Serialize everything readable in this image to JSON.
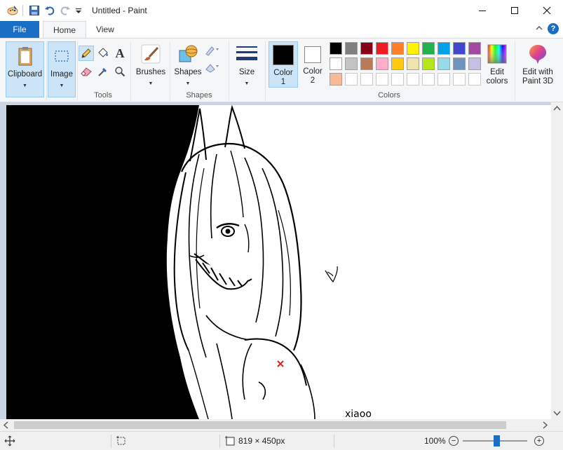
{
  "window": {
    "title": "Untitled - Paint",
    "controls": {
      "minimize": "—",
      "maximize": "☐",
      "close": "✕"
    }
  },
  "tabs": {
    "file": "File",
    "home": "Home",
    "view": "View"
  },
  "ribbon": {
    "clipboard": {
      "label": "Clipboard"
    },
    "image": {
      "label": "Image"
    },
    "tools": {
      "label": "Tools"
    },
    "brushes": {
      "label": "Brushes"
    },
    "shapes": {
      "label": "Shapes",
      "group_label": "Shapes"
    },
    "size": {
      "label": "Size"
    },
    "color1": {
      "label": "Color",
      "num": "1",
      "color": "#000000"
    },
    "color2": {
      "label": "Color",
      "num": "2",
      "color": "#ffffff"
    },
    "colors_group_label": "Colors",
    "edit_colors": {
      "line1": "Edit",
      "line2": "colors"
    },
    "paint3d": {
      "line1": "Edit with",
      "line2": "Paint 3D"
    },
    "palette_row1": [
      "#000000",
      "#7f7f7f",
      "#880015",
      "#ed1c24",
      "#ff7f27",
      "#fff200",
      "#22b14c",
      "#00a2e8",
      "#3f48cc",
      "#a349a4"
    ],
    "palette_row2": [
      "#ffffff",
      "#c3c3c3",
      "#b97a57",
      "#ffaec9",
      "#ffc90e",
      "#efe4b0",
      "#b5e61d",
      "#99d9ea",
      "#7092be",
      "#c8bfe7"
    ],
    "palette_row3": [
      "#f7b99a"
    ]
  },
  "canvas": {
    "signature": "xiaoo"
  },
  "status": {
    "dimensions": "819 × 450px",
    "zoom": "100%"
  }
}
